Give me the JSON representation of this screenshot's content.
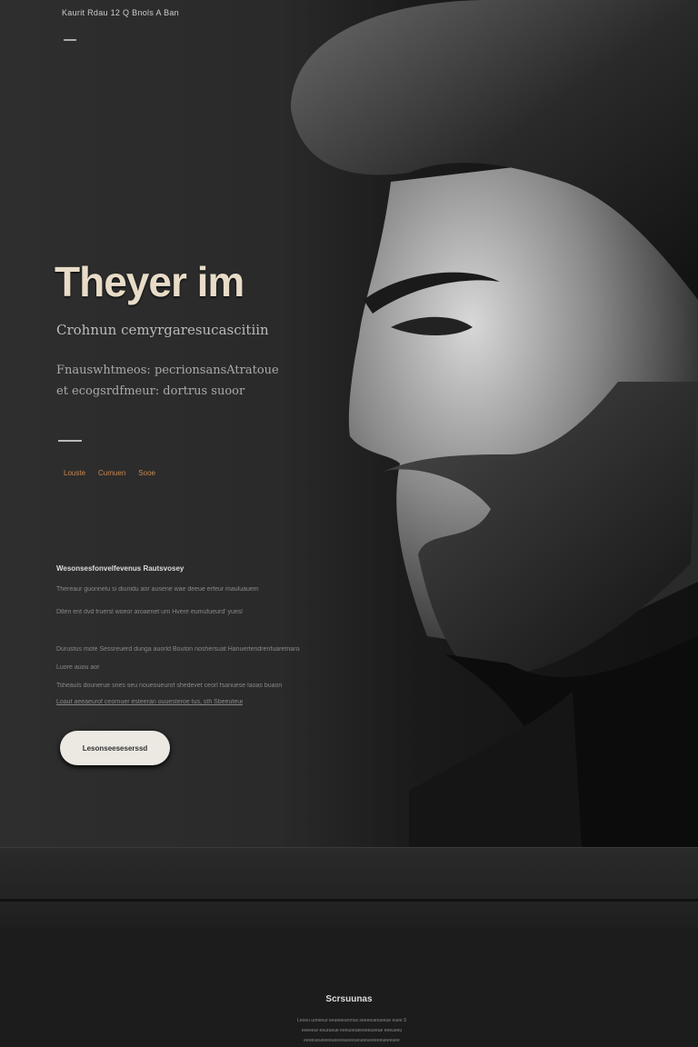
{
  "header": {
    "tagline": "Kaurit Rdau 12 Q Bnols A Ban"
  },
  "hero": {
    "title": "Theyer im",
    "subtitle": "Crohnun cemyrgaresucascitiin",
    "description": "Fnauswhtmeos: pecrionsansAtratoue et ecogsrdfmeur: dortrus suoor",
    "links": [
      "Louste",
      "Cumuen",
      "Sooe"
    ],
    "section_heading": "Wesonsesfonvelfevenus Rautsvosey",
    "paragraphs": [
      "Thereaur guonnelu si diunidu aor ausene wae deeue erfeur mauluauem",
      "Dtlen ent dvd fruersl woeor aroaenet urn Hvere eumufueurd' yuesl",
      "Durustus mote Sessreuerd dunga auorld Bouton noshersuat Hanuertendrenfuaretnaroas. hu",
      "Luore auou aor",
      "Tsheauls dounerue snes seu noueoueurof shedevet ceorl fsanuese laoas buaorn hauese",
      "Loaut aeeaeurof ceornuer esteeran ouuesteroe tus, sth Sbeeuteue ceorseurd"
    ],
    "cta_label": "Lesonseeseserssd"
  },
  "footer": {
    "title": "Scrsuunas",
    "lines": [
      "Leoeu uoneeur eeueeeuronus seeeeuerueeue euee Seeeueeeuens",
      "eeeeeur eeurueue eeeuoeueeeeeueeue eeeueeu",
      "eeeeueueeeeueeeeueeeueueeueeeeeueeeuee"
    ]
  }
}
